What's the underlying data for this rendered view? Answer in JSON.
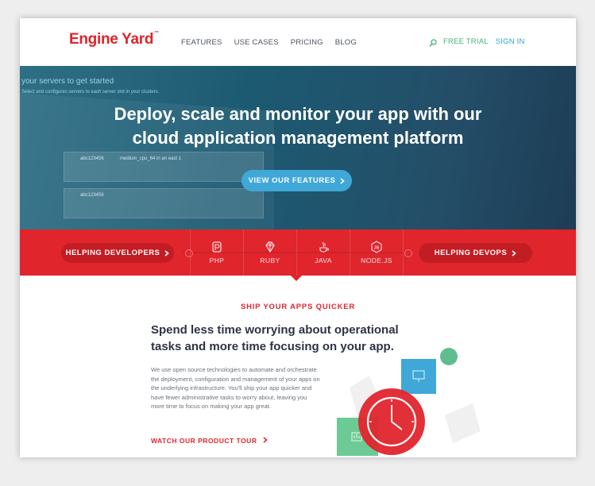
{
  "brand": {
    "name": "Engine Yard",
    "mark": "™",
    "color": "#e0222a"
  },
  "nav": {
    "items": [
      "FEATURES",
      "USE CASES",
      "PRICING",
      "BLOG"
    ]
  },
  "header_right": {
    "search_icon": "search-icon",
    "free_trial": "FREE TRIAL",
    "sign_in": "SIGN IN"
  },
  "hero": {
    "screen_text_1": "your servers to get started",
    "screen_text_2": "Select and configures servers to each server slot in your clusters.",
    "row_1_id": "abc123456",
    "row_1_meta": "medium_cpu_64 in an east 1",
    "row_2_id": "abc123456",
    "title_line_1": "Deploy, scale and monitor your app with our",
    "title_line_2": "cloud application management platform",
    "cta": "VIEW OUR FEATURES"
  },
  "band": {
    "left_pill": "HELPING DEVELOPERS",
    "right_pill": "HELPING DEVOPS",
    "languages": [
      {
        "label": "PHP",
        "icon": "php-icon"
      },
      {
        "label": "RUBY",
        "icon": "ruby-icon"
      },
      {
        "label": "JAVA",
        "icon": "java-icon"
      },
      {
        "label": "NODE.JS",
        "icon": "nodejs-icon"
      }
    ]
  },
  "section": {
    "eyebrow": "SHIP YOUR APPS QUICKER",
    "headline": "Spend less time worrying about operational tasks and more time focusing on your app.",
    "body": "We use open source technologies to automate and orchestrate the deployment, configuration and management of your apps on the underlying infrastructure. You'll ship your app quicker and have fewer administrative tasks to worry about, leaving you more time to focus on making your app great.",
    "link": "WATCH OUR PRODUCT TOUR"
  },
  "colors": {
    "red": "#e0252d",
    "blue": "#3fa8d8",
    "green": "#43b17a",
    "dark": "#2d3446"
  }
}
